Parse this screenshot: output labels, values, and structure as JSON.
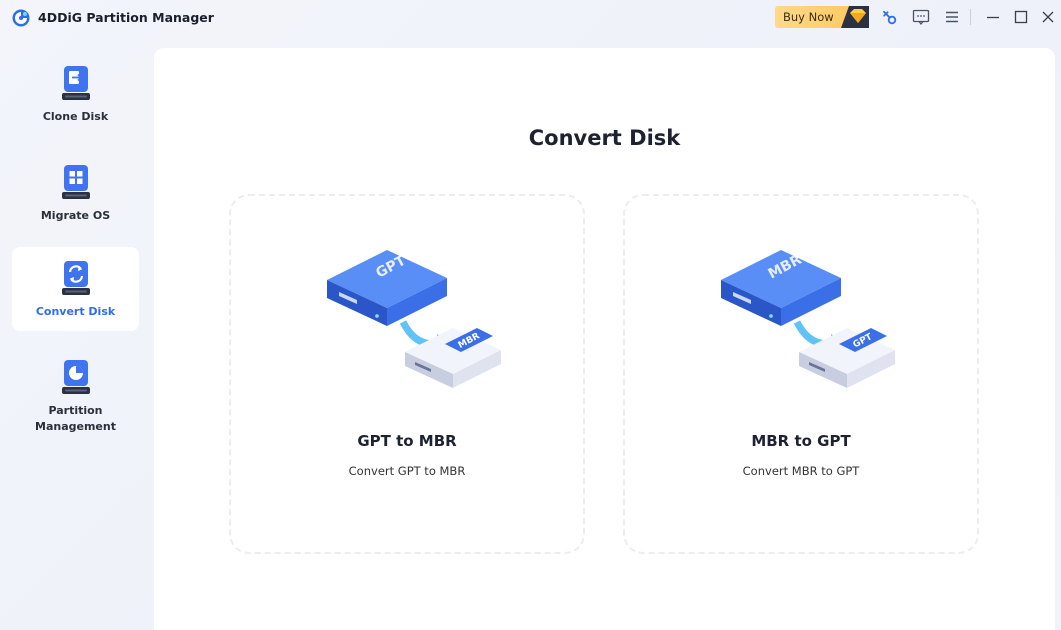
{
  "window": {
    "title": "4DDiG Partition Manager",
    "buy_now_label": "Buy Now"
  },
  "titlebar_icons": [
    "key-icon",
    "feedback-icon",
    "menu-icon",
    "minimize-icon",
    "maximize-icon",
    "close-icon"
  ],
  "sidebar": {
    "items": [
      {
        "label": "Clone Disk",
        "icon": "clone-disk-icon",
        "active": false
      },
      {
        "label": "Migrate OS",
        "icon": "migrate-os-icon",
        "active": false
      },
      {
        "label": "Convert Disk",
        "icon": "convert-disk-icon",
        "active": true
      },
      {
        "label": "Partition\nManagement",
        "icon": "partition-management-icon",
        "active": false
      }
    ]
  },
  "main": {
    "title": "Convert Disk",
    "cards": [
      {
        "title": "GPT to MBR",
        "subtitle": "Convert GPT to MBR",
        "from": "GPT",
        "to": "MBR"
      },
      {
        "title": "MBR to GPT",
        "subtitle": "Convert MBR to GPT",
        "from": "MBR",
        "to": "GPT"
      }
    ]
  },
  "colors": {
    "accent": "#2e6ee8",
    "buy_now_bg": "#fbc65b",
    "disk_blue": "#3a6fe8",
    "disk_grey": "#e3e6f3"
  }
}
